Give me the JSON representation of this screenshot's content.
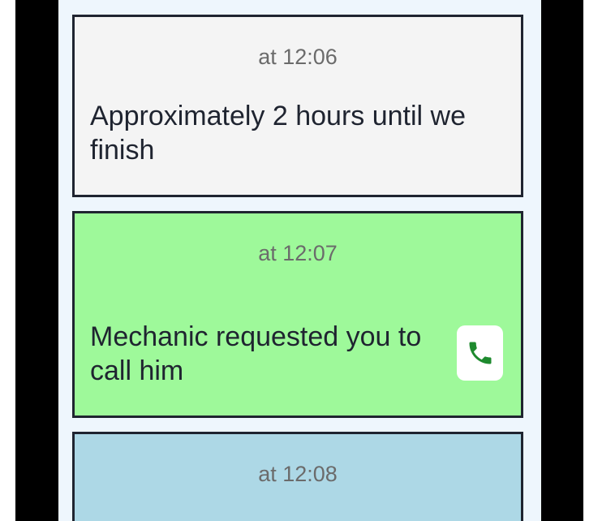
{
  "messages": [
    {
      "time": "at 12:06",
      "text": "Approximately 2 hours until we finish",
      "color": "#f4f4f4"
    },
    {
      "time": "at 12:07",
      "text": "Mechanic requested you to call him",
      "color": "#9ef99a",
      "action_icon": "phone-icon",
      "action_icon_color": "#1e8a2e"
    },
    {
      "time": "at 12:08",
      "text": "",
      "color": "#add8e6"
    }
  ]
}
